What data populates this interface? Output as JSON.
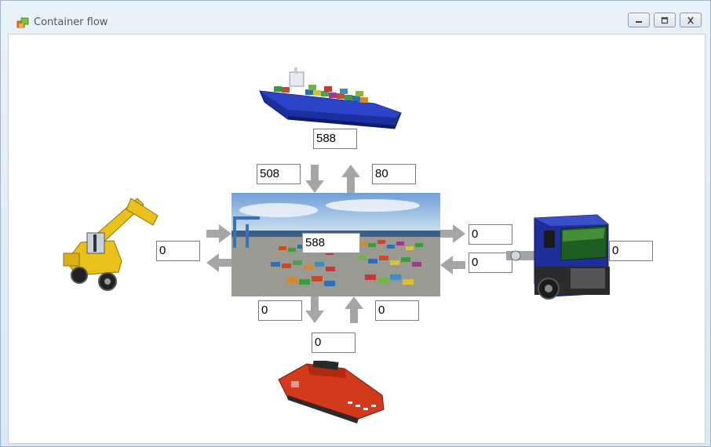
{
  "window": {
    "title": "Container flow",
    "icon": "container-flow-app-icon",
    "controls": [
      "minimize-icon",
      "maximize-icon",
      "close-icon"
    ]
  },
  "flow": {
    "ship_total": "588",
    "ship_in": "508",
    "ship_out": "80",
    "yard_total": "588",
    "truck_out": "0",
    "truck_in": "0",
    "truck_total": "0",
    "reachstacker_in": "0",
    "reachstacker_total": "0",
    "train_out": "0",
    "train_in": "0",
    "train_total": "0"
  },
  "colors": {
    "arrow": "#a6a6a6",
    "field_border": "#7a7a7a",
    "ship_hull": "#1c2f9e",
    "truck_cab": "#1e2f9b",
    "crane_yellow": "#e8c21a",
    "locomotive_red": "#d23a1b"
  }
}
